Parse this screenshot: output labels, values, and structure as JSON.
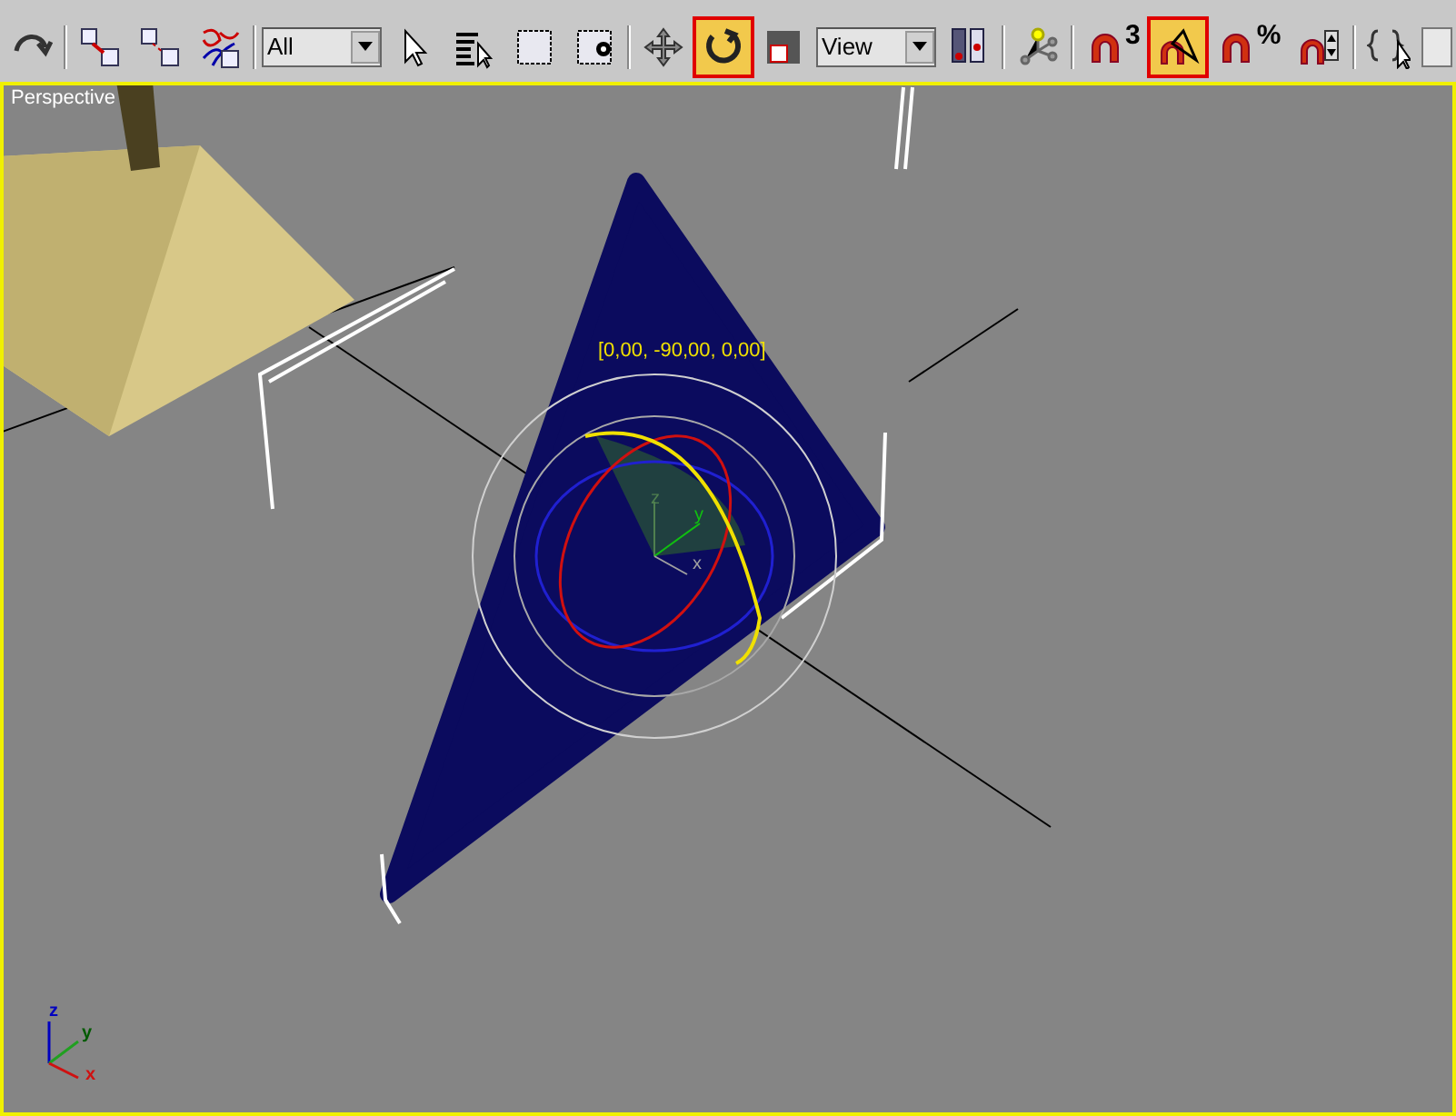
{
  "toolbar": {
    "items": [
      {
        "kind": "button",
        "active": false
      },
      {
        "kind": "separator"
      },
      {
        "kind": "button",
        "active": false
      },
      {
        "kind": "button",
        "active": false
      },
      {
        "kind": "button",
        "active": false
      },
      {
        "kind": "separator"
      },
      {
        "kind": "dropdown",
        "value": "All"
      },
      {
        "kind": "button",
        "active": false
      },
      {
        "kind": "button",
        "active": false
      },
      {
        "kind": "button",
        "active": false
      },
      {
        "kind": "button",
        "active": false
      },
      {
        "kind": "separator"
      },
      {
        "kind": "button",
        "active": false
      },
      {
        "kind": "button",
        "active": true
      },
      {
        "kind": "button",
        "active": false
      },
      {
        "kind": "dropdown",
        "value": "View"
      },
      {
        "kind": "button",
        "active": false
      },
      {
        "kind": "separator"
      },
      {
        "kind": "button",
        "active": false
      },
      {
        "kind": "separator"
      },
      {
        "kind": "button",
        "active": false,
        "mark": "3"
      },
      {
        "kind": "button",
        "active": true
      },
      {
        "kind": "button",
        "active": false,
        "mark": "%"
      },
      {
        "kind": "button",
        "active": false
      },
      {
        "kind": "separator"
      },
      {
        "kind": "button",
        "active": false
      },
      {
        "kind": "field"
      }
    ]
  },
  "viewport": {
    "label": "Perspective",
    "readout": "[0,00, -90,00, 0,00]",
    "gizmo_axes": [
      {
        "label": "z",
        "color": "#4f7f4f"
      },
      {
        "label": "y",
        "color": "#10c010"
      },
      {
        "label": "x",
        "color": "#a0a0a0"
      }
    ],
    "tripod_axes": [
      {
        "label": "z",
        "color": "#0000c0"
      },
      {
        "label": "y",
        "color": "#005a00"
      },
      {
        "label": "x",
        "color": "#d01010"
      }
    ]
  }
}
